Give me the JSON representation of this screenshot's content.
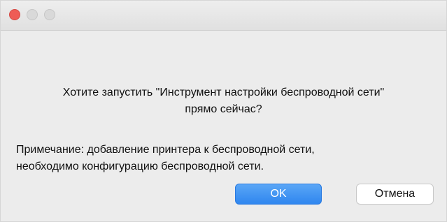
{
  "dialog": {
    "question_line1": "Хотите запустить \"Инструмент настройки беспроводной сети\"",
    "question_line2": "прямо сейчас?",
    "note_line1": "Примечание: добавление принтера к беспроводной сети,",
    "note_line2": "необходимо конфигурацию беспроводной сети.",
    "ok_label": "OK",
    "cancel_label": "Отмена"
  },
  "colors": {
    "accent": "#2f86ef",
    "close_light": "#ee5c56",
    "window_bg": "#ececec"
  }
}
